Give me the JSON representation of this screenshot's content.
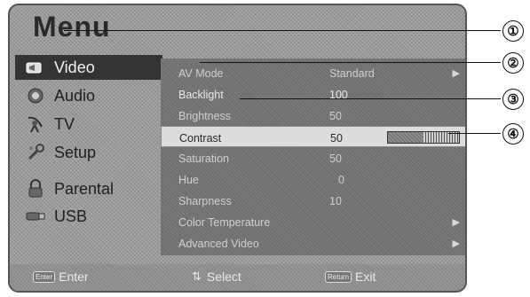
{
  "menu": {
    "title": "Menu"
  },
  "sidebar": {
    "items": [
      {
        "label": "Video",
        "icon": "video-icon",
        "selected": true
      },
      {
        "label": "Audio",
        "icon": "audio-icon"
      },
      {
        "label": "TV",
        "icon": "tv-antenna-icon"
      },
      {
        "label": "Setup",
        "icon": "wrench-icon"
      },
      {
        "label": "Parental",
        "icon": "lock-icon"
      },
      {
        "label": "USB",
        "icon": "usb-icon"
      }
    ]
  },
  "settings": [
    {
      "label": "AV Mode",
      "value": "Standard",
      "has_arrow": true
    },
    {
      "label": "Backlight",
      "value": "100"
    },
    {
      "label": "Brightness",
      "value": "50"
    },
    {
      "label": "Contrast",
      "value": "50",
      "selected": true,
      "level": 0.5
    },
    {
      "label": "Saturation",
      "value": "50"
    },
    {
      "label": "Hue",
      "value": "0"
    },
    {
      "label": "Sharpness",
      "value": "10"
    },
    {
      "label": "Color Temperature",
      "value": "",
      "has_arrow": true
    },
    {
      "label": "Advanced Video",
      "value": "",
      "has_arrow": true
    }
  ],
  "footer": {
    "enter_key": "Enter",
    "enter_label": "Enter",
    "select_label": "Select",
    "return_key": "Return",
    "exit_label": "Exit"
  },
  "callouts": [
    "①",
    "②",
    "③",
    "④"
  ],
  "colors": {
    "selected_bg": "#333333",
    "row_highlight": "#dcdcdc"
  }
}
